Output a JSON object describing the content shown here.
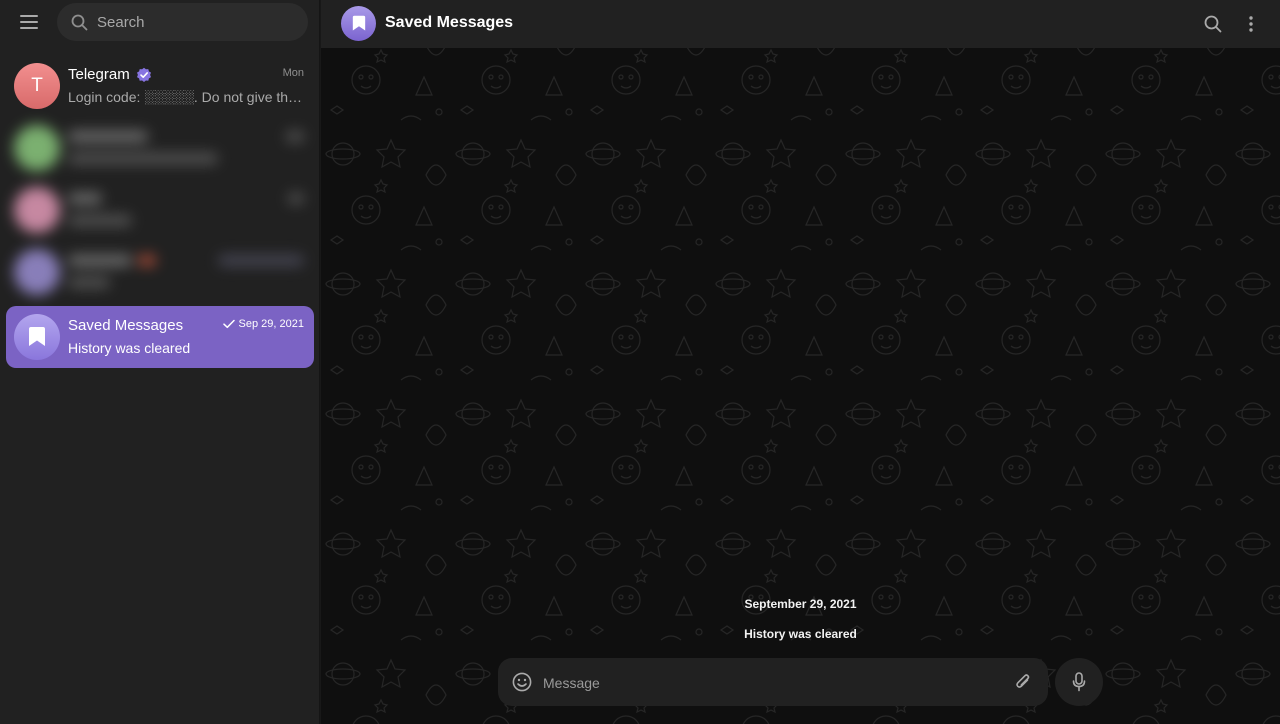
{
  "sidebar": {
    "search_placeholder": "Search",
    "chats": [
      {
        "name": "Telegram",
        "preview": "Login code: ░░░░░. Do not give this c...",
        "time": "Mon",
        "avatar_letter": "T",
        "verified": true
      },
      {
        "name": "",
        "preview": "",
        "time": "",
        "blurred": true
      },
      {
        "name": "",
        "preview": "",
        "time": "",
        "blurred": true
      },
      {
        "name": "",
        "preview": "",
        "time": "",
        "blurred": true
      },
      {
        "name": "Saved Messages",
        "preview": "History was cleared",
        "time": "Sep 29, 2021",
        "active": true,
        "read_check": true
      }
    ]
  },
  "chat": {
    "title": "Saved Messages",
    "date_separator": "September 29, 2021",
    "service_message": "History was cleared",
    "composer_placeholder": "Message"
  },
  "colors": {
    "accent": "#7b63c4",
    "sidebar_bg": "#212121",
    "chat_bg": "#0f0f0f",
    "telegram_avatar": "#d86a6a",
    "verified_badge": "#8774e1"
  },
  "icons": [
    "menu-icon",
    "search-icon",
    "verified-icon",
    "bookmark-icon",
    "check-icon",
    "more-vertical-icon",
    "emoji-icon",
    "attach-icon",
    "mic-icon"
  ]
}
